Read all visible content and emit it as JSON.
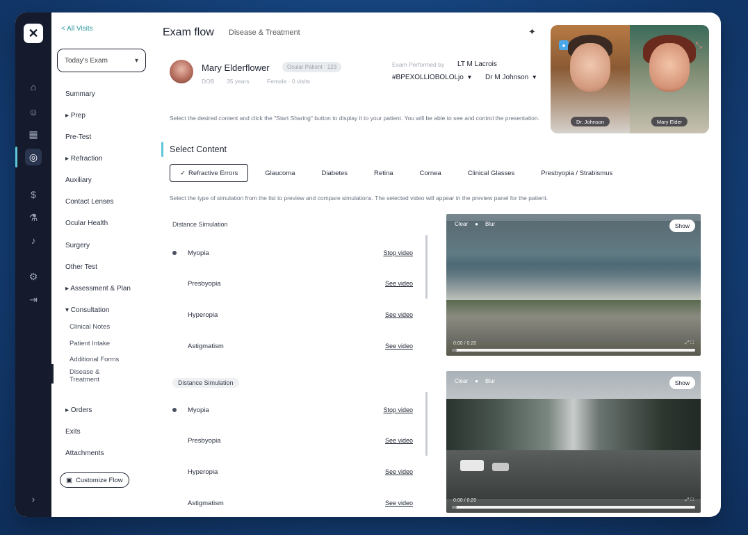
{
  "rail": {
    "icons": [
      "home-icon",
      "people-icon",
      "calendar-icon",
      "exam-icon",
      "dollar-icon",
      "flask-icon",
      "bell-icon",
      "settings-icon",
      "logout-icon",
      "collapse-icon"
    ]
  },
  "nav": {
    "back_label": "< All Visits",
    "visit_select": "Today's Exam",
    "items": [
      {
        "label": "Summary",
        "level": 0
      },
      {
        "label": "▸ Prep",
        "level": 0
      },
      {
        "label": "Pre-Test",
        "level": 0
      },
      {
        "label": "▸ Refraction",
        "level": 0
      },
      {
        "label": "Auxiliary",
        "level": 0
      },
      {
        "label": "Contact Lenses",
        "level": 0
      },
      {
        "label": "Ocular Health",
        "level": 0
      },
      {
        "label": "Surgery",
        "level": 0
      },
      {
        "label": "Other Test",
        "level": 0
      },
      {
        "label": "▸ Assessment & Plan",
        "level": 0
      },
      {
        "label": "▾ Consultation",
        "level": 0
      },
      {
        "label": "Clinical Notes",
        "level": 1
      },
      {
        "label": "Patient Intake",
        "level": 1
      },
      {
        "label": "Additional Forms",
        "level": 1
      },
      {
        "label": "Disease & Treatment",
        "level": 1
      },
      {
        "label": "▸ Orders",
        "level": 0
      },
      {
        "label": "Exits",
        "level": 0
      },
      {
        "label": "Attachments",
        "level": 0
      }
    ],
    "customize_label": "Customize Flow"
  },
  "header": {
    "title": "Exam flow",
    "subtitle": "Disease & Treatment"
  },
  "patient": {
    "name": "Mary Elderflower",
    "badge": "Ocular Patient · 123",
    "meta": [
      "DOB",
      "35 years",
      "Female · 0 visits"
    ],
    "provider_label": "Exam Performed by",
    "provider_name": "LT M Lacrois",
    "location_select": "#BPEXOLLIOBOLOLjo",
    "doctor_select": "Dr M Johnson"
  },
  "video_call": {
    "participants": [
      {
        "name": "Dr. Johnson"
      },
      {
        "name": "Mary Elder"
      }
    ]
  },
  "instructions": "Select the desired content and click the \"Start Sharing\" button to display it to your patient. You will be able to see and control the presentation.",
  "section_title": "Select Content",
  "tabs": [
    {
      "label": "Refractive Errors",
      "active": true
    },
    {
      "label": "Glaucoma",
      "active": false
    },
    {
      "label": "Diabetes",
      "active": false
    },
    {
      "label": "Retina",
      "active": false
    },
    {
      "label": "Cornea",
      "active": false
    },
    {
      "label": "Clinical Glasses",
      "active": false
    },
    {
      "label": "Presbyopia / Strabismus",
      "active": false
    }
  ],
  "tabs_description": "Select the type of simulation from the list to preview and compare simulations. The selected video will appear in the preview panel for the patient.",
  "groups": [
    {
      "label": "Distance Simulation",
      "rows": [
        {
          "name": "Myopia",
          "link": "Stop video",
          "active": true
        },
        {
          "name": "Presbyopia",
          "link": "See video",
          "active": false
        },
        {
          "name": "Hyperopia",
          "link": "See video",
          "active": false
        },
        {
          "name": "Astigmatism",
          "link": "See video",
          "active": false
        }
      ]
    },
    {
      "label": "Distance Simulation",
      "rows": [
        {
          "name": "Myopia",
          "link": "Stop video",
          "active": true
        },
        {
          "name": "Presbyopia",
          "link": "See video",
          "active": false
        },
        {
          "name": "Hyperopia",
          "link": "See video",
          "active": false
        },
        {
          "name": "Astigmatism",
          "link": "See video",
          "active": false
        }
      ]
    }
  ],
  "players": [
    {
      "label_left": "Clear",
      "label_right": "Blur",
      "show_label": "Show",
      "time": "0:00 / 0:20",
      "ctrls": "⤢ ⛶",
      "progress": 0.02
    },
    {
      "label_left": "Clear",
      "label_right": "Blur",
      "show_label": "Show",
      "time": "0:00 / 0:20",
      "ctrls": "⤢ ⛶",
      "progress": 0.02
    }
  ]
}
